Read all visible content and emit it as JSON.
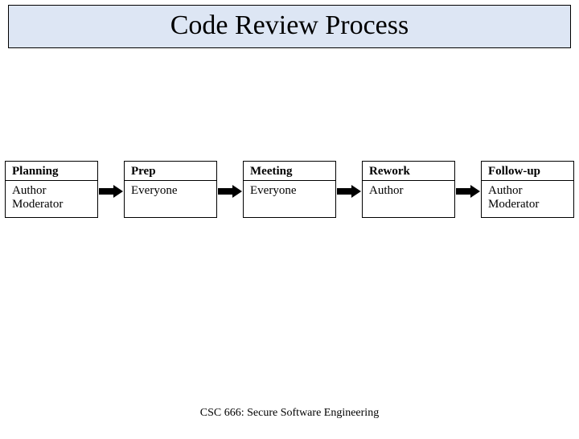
{
  "title": "Code Review Process",
  "stages": [
    {
      "name": "Planning",
      "who": [
        "Author",
        "Moderator"
      ]
    },
    {
      "name": "Prep",
      "who": [
        "Everyone"
      ]
    },
    {
      "name": "Meeting",
      "who": [
        "Everyone"
      ]
    },
    {
      "name": "Rework",
      "who": [
        "Author"
      ]
    },
    {
      "name": "Follow-up",
      "who": [
        "Author",
        "Moderator"
      ]
    }
  ],
  "footer": "CSC 666: Secure Software Engineering"
}
